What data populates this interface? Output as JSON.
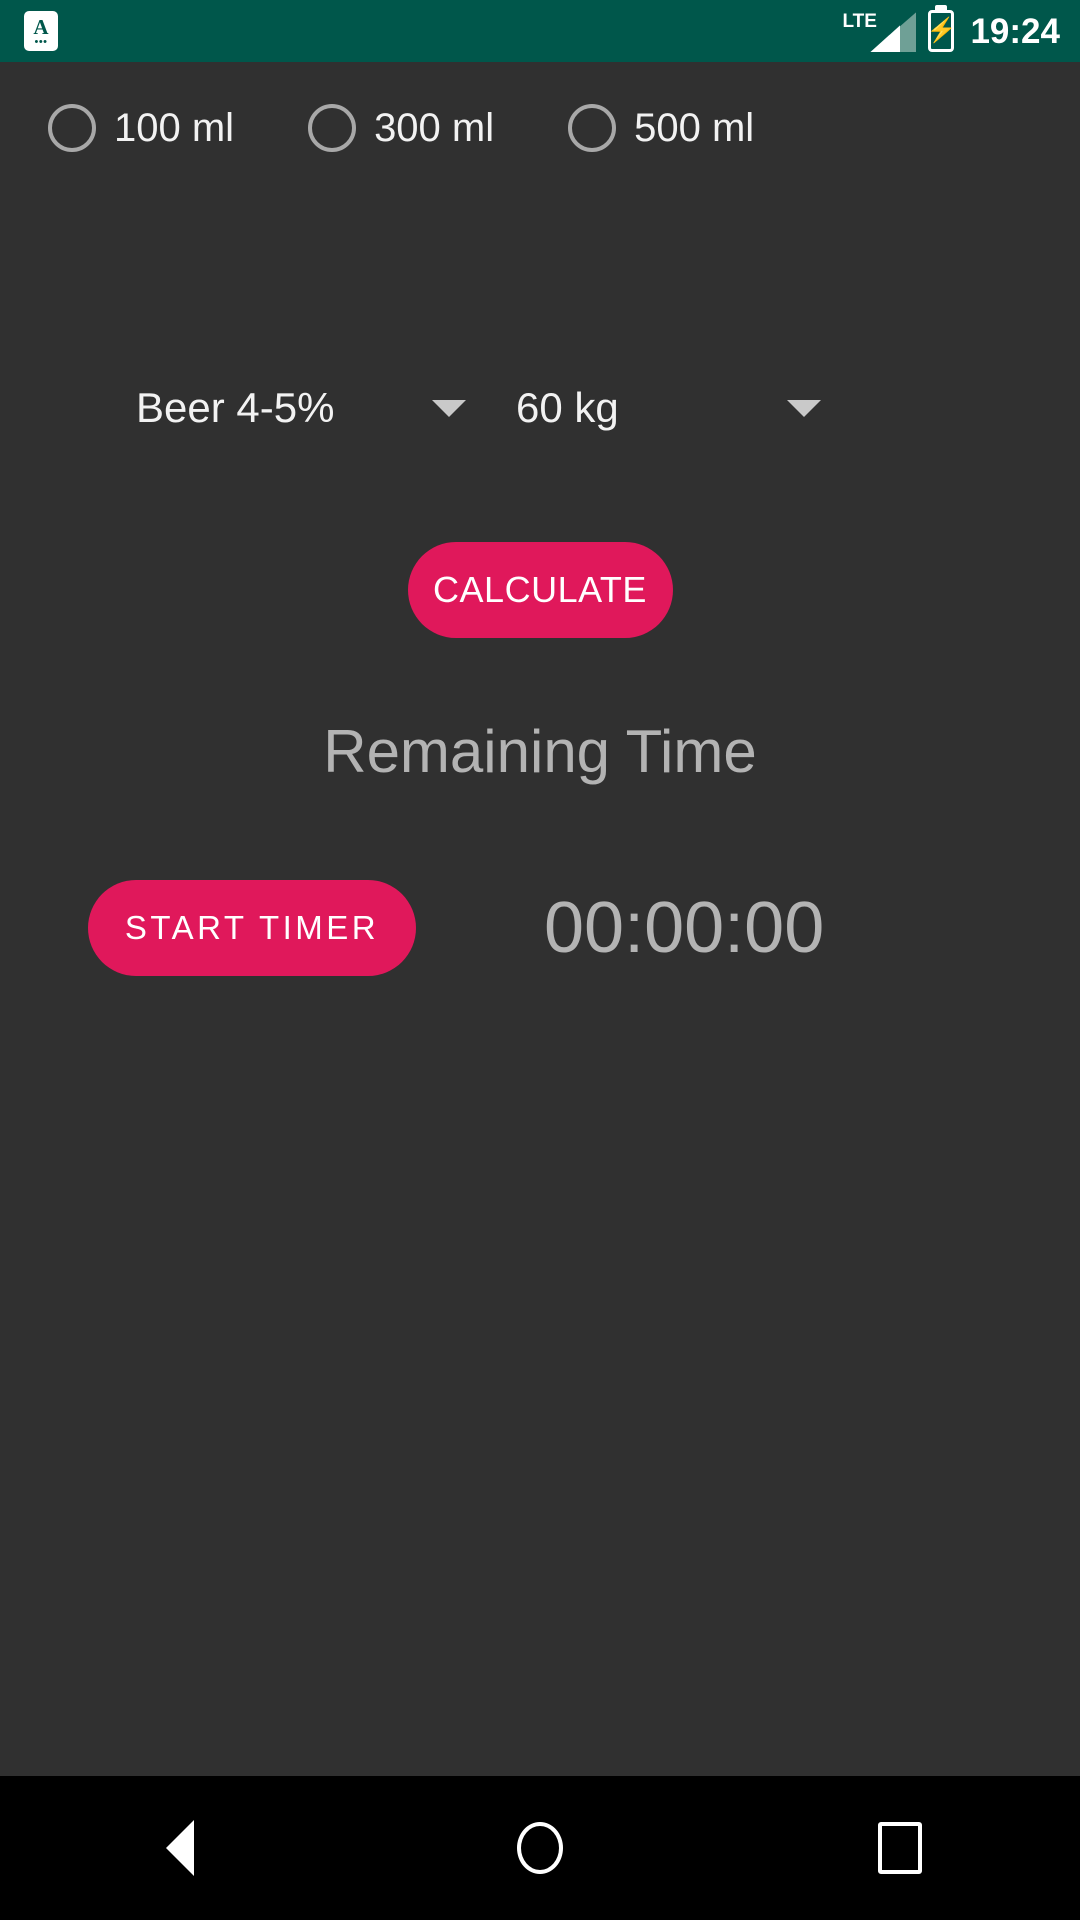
{
  "status_bar": {
    "background_color": "#00574B",
    "notification_icon": "app-notification-icon",
    "notification_glyph": "A",
    "notification_dots": "•••",
    "network_label": "LTE",
    "signal_icon": "signal-bars-icon",
    "battery_icon": "battery-charging-icon",
    "battery_glyph": "⚡",
    "time": "19:24"
  },
  "app": {
    "background_color": "#303030",
    "accent_color": "#E0185B",
    "volume_options": [
      {
        "label": "100 ml",
        "selected": false
      },
      {
        "label": "300 ml",
        "selected": false
      },
      {
        "label": "500 ml",
        "selected": false
      }
    ],
    "dropdowns": {
      "alcohol": {
        "value": "Beer 4-5%",
        "arrow_icon": "chevron-down-icon"
      },
      "weight": {
        "value": "60 kg",
        "arrow_icon": "chevron-down-icon"
      }
    },
    "calculate_label": "CALCULATE",
    "remaining_time_label": "Remaining Time",
    "start_timer_label": "START TIMER",
    "timer_value": "00:00:00"
  },
  "nav_bar": {
    "background_color": "#000000",
    "back_icon": "back-triangle-icon",
    "home_icon": "home-circle-icon",
    "recents_icon": "recents-square-icon"
  }
}
